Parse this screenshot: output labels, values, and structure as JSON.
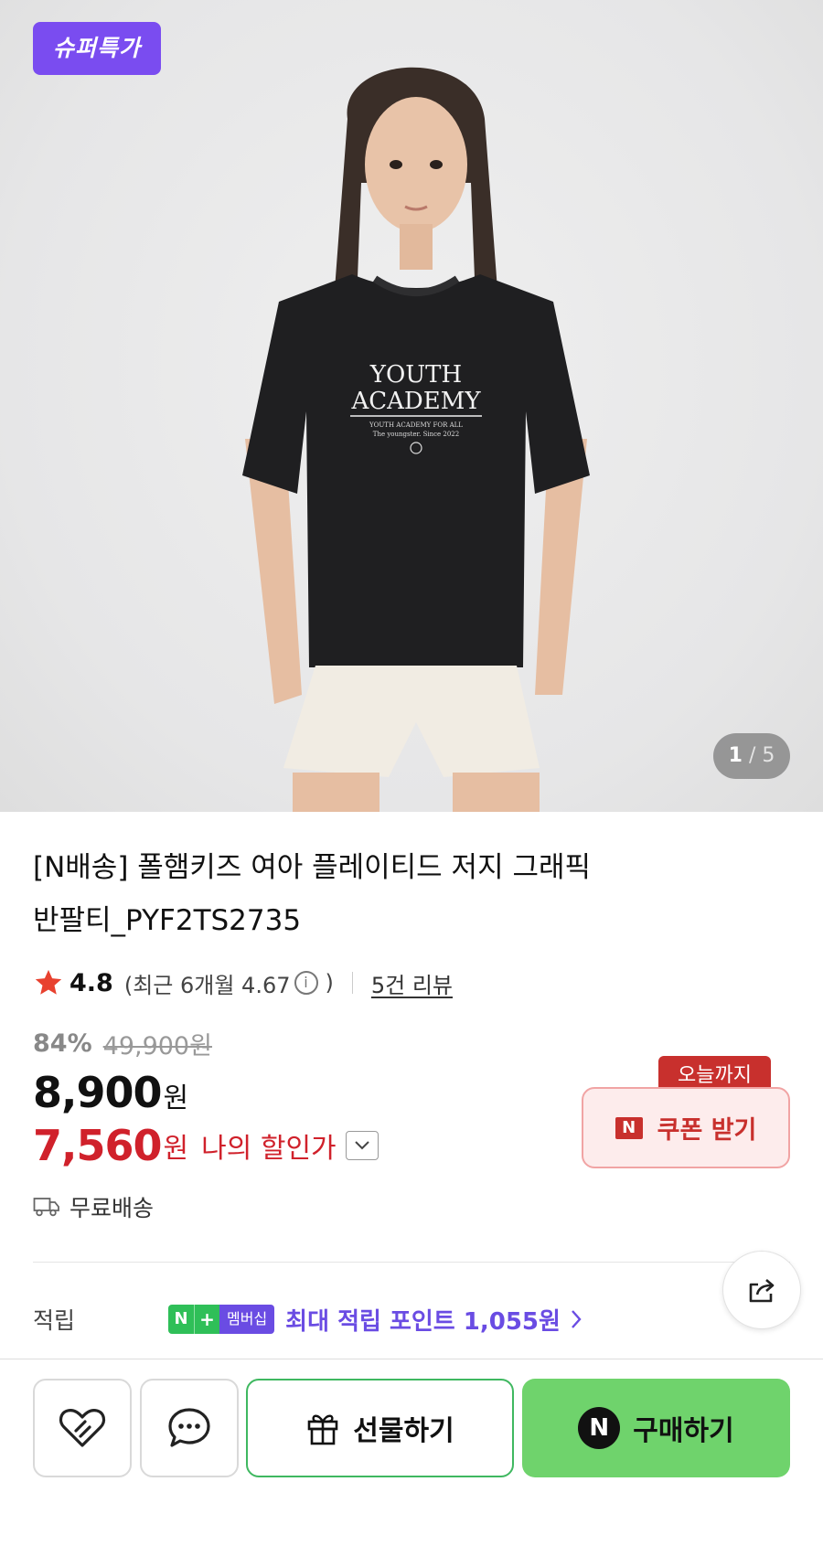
{
  "hero": {
    "badge": "슈퍼특가",
    "counter_current": "1",
    "counter_sep": "/",
    "counter_total": "5"
  },
  "product": {
    "title_line1": "[N배송] 폴햄키즈 여아 플레이티드 저지 그래픽",
    "title_line2": "반팔티_PYF2TS2735",
    "rating": "4.8",
    "recent_prefix": "(최근 6개월 4.67",
    "recent_suffix": ")",
    "info_glyph": "i",
    "review_link": "5건 리뷰",
    "discount_pct": "84%",
    "original_price": "49,900원",
    "price": "8,900",
    "price_unit": "원",
    "my_price": "7,560",
    "my_price_unit": "원",
    "my_price_label": "나의 할인가",
    "delivery": "무료배송"
  },
  "coupon": {
    "tag": "오늘까지",
    "n_mark": "N",
    "label": "쿠폰 받기"
  },
  "points": {
    "label": "적립",
    "badge_n": "N",
    "badge_plus": "+",
    "badge_label": "멤버십",
    "text": "최대 적립 포인트 1,055원"
  },
  "bottom": {
    "gift_label": "선물하기",
    "buy_n": "N",
    "buy_label": "구매하기"
  },
  "colors": {
    "badge_purple": "#7a4cf0",
    "price_red": "#d0212b",
    "coupon_red": "#c8302d",
    "membership_green": "#2fbf58",
    "membership_purple": "#6a4ce3",
    "buy_green": "#6fd36c"
  },
  "icons": [
    "heart-link-icon",
    "chat-bubble-icon",
    "gift-icon",
    "share-icon",
    "truck-icon",
    "star-icon",
    "chevron-down-icon",
    "chevron-right-icon",
    "info-icon"
  ]
}
